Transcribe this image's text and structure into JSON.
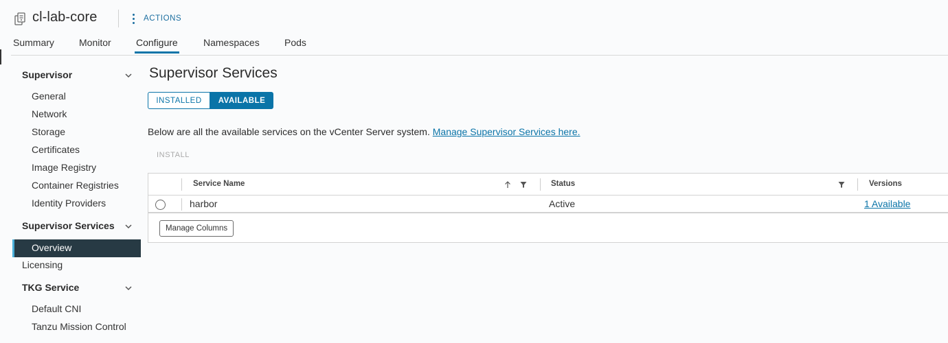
{
  "header": {
    "title": "cl-lab-core",
    "actions_label": "ACTIONS"
  },
  "tabs": [
    {
      "label": "Summary"
    },
    {
      "label": "Monitor"
    },
    {
      "label": "Configure",
      "active": true
    },
    {
      "label": "Namespaces"
    },
    {
      "label": "Pods"
    }
  ],
  "sidebar": {
    "supervisor": {
      "label": "Supervisor",
      "items": [
        "General",
        "Network",
        "Storage",
        "Certificates",
        "Image Registry",
        "Container Registries",
        "Identity Providers"
      ]
    },
    "supervisor_services": {
      "label": "Supervisor Services",
      "active_item": "Overview"
    },
    "licensing": "Licensing",
    "tkg_service": {
      "label": "TKG Service",
      "items": [
        "Default CNI",
        "Tanzu Mission Control"
      ]
    }
  },
  "main": {
    "title": "Supervisor Services",
    "toggle": {
      "installed": "INSTALLED",
      "available": "AVAILABLE",
      "selected": "AVAILABLE"
    },
    "description": "Below are all the available services on the vCenter Server system.",
    "manage_link": "Manage Supervisor Services here.",
    "install_label": "INSTALL",
    "grid": {
      "columns": [
        "Service Name",
        "Status",
        "Versions"
      ],
      "rows": [
        {
          "name": "harbor",
          "status": "Active",
          "versions": "1 Available"
        }
      ],
      "manage_columns_label": "Manage Columns"
    }
  },
  "colors": {
    "accent": "#0a74a8",
    "sidebar_active_bg": "#273a44",
    "sidebar_active_border": "#49afd9"
  }
}
